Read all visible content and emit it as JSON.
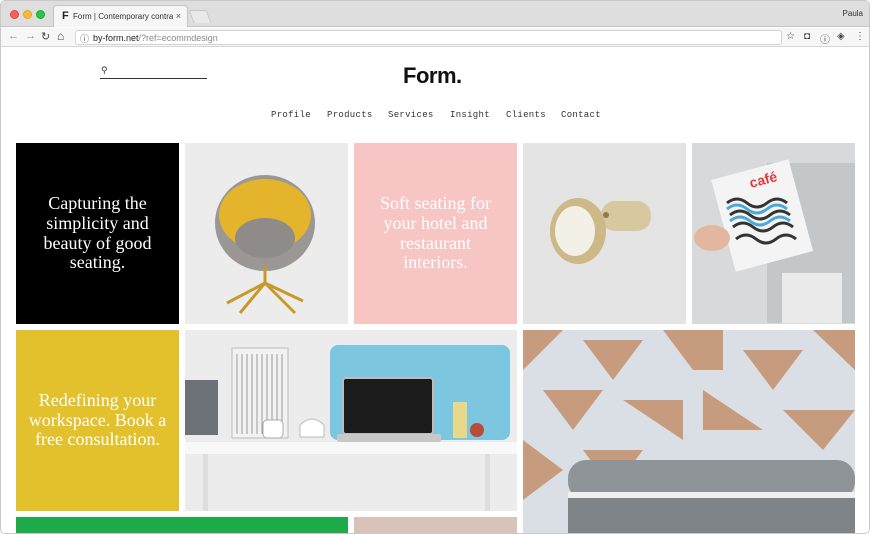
{
  "browser": {
    "tab_favicon": "F",
    "tab_title": "Form | Contemporary contract",
    "tab_close": "×",
    "user_name": "Paula",
    "url_host": "by-form.net",
    "url_path": "/?ref=ecommdesign",
    "info_icon": "ⓘ"
  },
  "header": {
    "search_icon": "⚲",
    "logo": "Form."
  },
  "menu": [
    "Profile",
    "Products",
    "Services",
    "Insight",
    "Clients",
    "Contact"
  ],
  "tiles": {
    "capturing": "Capturing the simplicity and beauty of good seating.",
    "soft_seating": "Soft seating for your hotel and restaurant interiors.",
    "redefining": "Redefining your workspace. Book a free consultation."
  },
  "colors": {
    "black_tile": "#000000",
    "pink_tile": "#f7c5c4",
    "yellow_tile": "#e3c12c",
    "green_tile": "#1dab4a"
  },
  "icons": [
    "back-arrow-icon",
    "forward-arrow-icon",
    "reload-icon",
    "home-icon",
    "star-icon",
    "pocket-icon",
    "info-icon",
    "layers-icon",
    "more-icon"
  ]
}
